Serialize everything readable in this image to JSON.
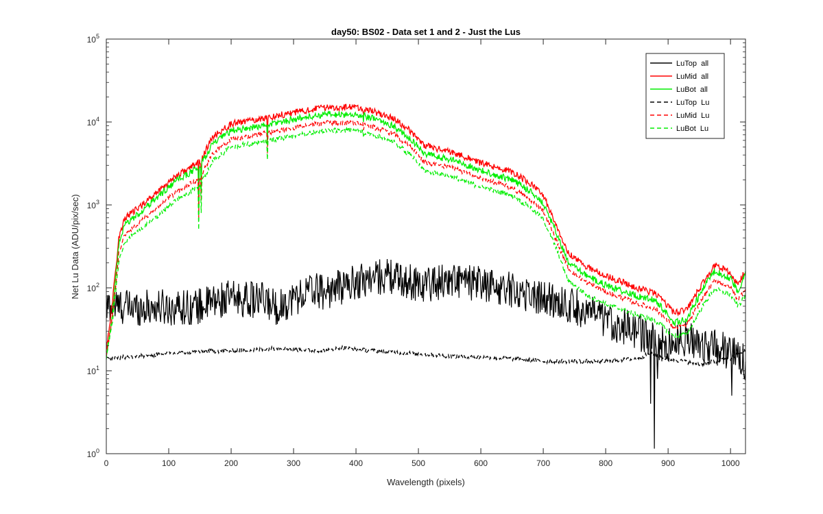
{
  "chart_data": {
    "type": "line",
    "title": "day50: BS02 - Data set 1 and 2 - Just the Lus",
    "xlabel": "Wavelength (pixels)",
    "ylabel": "Net Lu Data (ADU/pix/sec)",
    "xlim": [
      0,
      1024
    ],
    "ylim": [
      1,
      100000
    ],
    "yscale": "log",
    "grid": false,
    "legend_position": "top-right",
    "x_ticks": [
      "0",
      "100",
      "200",
      "300",
      "400",
      "500",
      "600",
      "700",
      "800",
      "900",
      "1000"
    ],
    "y_tick_exponents": [
      "0",
      "1",
      "2",
      "3",
      "4",
      "5"
    ],
    "y_tick_base": "10",
    "series": [
      {
        "name": "LuTop  all",
        "color": "#000000",
        "dash": "solid",
        "noise": 0.22,
        "points": [
          [
            0,
            55
          ],
          [
            5,
            62
          ],
          [
            15,
            60
          ],
          [
            50,
            58
          ],
          [
            100,
            58
          ],
          [
            150,
            60
          ],
          [
            180,
            70
          ],
          [
            200,
            75
          ],
          [
            250,
            70
          ],
          [
            275,
            58
          ],
          [
            300,
            75
          ],
          [
            330,
            95
          ],
          [
            350,
            90
          ],
          [
            380,
            105
          ],
          [
            420,
            130
          ],
          [
            450,
            140
          ],
          [
            480,
            120
          ],
          [
            510,
            110
          ],
          [
            550,
            125
          ],
          [
            600,
            110
          ],
          [
            650,
            95
          ],
          [
            700,
            75
          ],
          [
            750,
            60
          ],
          [
            800,
            40
          ],
          [
            850,
            30
          ],
          [
            880,
            22
          ],
          [
            900,
            20
          ],
          [
            930,
            25
          ],
          [
            960,
            20
          ],
          [
            990,
            18
          ],
          [
            1024,
            13
          ]
        ],
        "spikes": [
          [
            878,
            1.15
          ],
          [
            872,
            4
          ],
          [
            883,
            8
          ],
          [
            1002,
            5
          ]
        ]
      },
      {
        "name": "LuMid  all",
        "color": "#ff0000",
        "dash": "solid",
        "noise": 0.04,
        "points": [
          [
            0,
            18
          ],
          [
            10,
            70
          ],
          [
            20,
            400
          ],
          [
            30,
            700
          ],
          [
            50,
            900
          ],
          [
            80,
            1400
          ],
          [
            110,
            2200
          ],
          [
            150,
            3300
          ],
          [
            170,
            6500
          ],
          [
            200,
            9500
          ],
          [
            250,
            11000
          ],
          [
            300,
            13000
          ],
          [
            350,
            15000
          ],
          [
            400,
            15000
          ],
          [
            420,
            14000
          ],
          [
            460,
            11000
          ],
          [
            490,
            7500
          ],
          [
            510,
            5200
          ],
          [
            560,
            4200
          ],
          [
            600,
            3200
          ],
          [
            650,
            2500
          ],
          [
            680,
            1800
          ],
          [
            700,
            1300
          ],
          [
            720,
            600
          ],
          [
            740,
            260
          ],
          [
            770,
            180
          ],
          [
            800,
            140
          ],
          [
            850,
            100
          ],
          [
            880,
            85
          ],
          [
            910,
            50
          ],
          [
            930,
            55
          ],
          [
            960,
            130
          ],
          [
            975,
            190
          ],
          [
            1000,
            150
          ],
          [
            1012,
            110
          ],
          [
            1024,
            160
          ]
        ],
        "spikes": [
          [
            148,
            1800
          ],
          [
            152,
            2200
          ],
          [
            258,
            6800
          ],
          [
            412,
            12500
          ],
          [
            420,
            13000
          ]
        ]
      },
      {
        "name": "LuBot  all",
        "color": "#00ee00",
        "dash": "solid",
        "noise": 0.04,
        "points": [
          [
            0,
            15
          ],
          [
            10,
            50
          ],
          [
            20,
            330
          ],
          [
            30,
            580
          ],
          [
            50,
            760
          ],
          [
            80,
            1200
          ],
          [
            110,
            1900
          ],
          [
            150,
            2900
          ],
          [
            170,
            5400
          ],
          [
            200,
            7800
          ],
          [
            250,
            9000
          ],
          [
            300,
            10800
          ],
          [
            350,
            12300
          ],
          [
            400,
            12300
          ],
          [
            420,
            11500
          ],
          [
            460,
            9000
          ],
          [
            490,
            6000
          ],
          [
            510,
            4100
          ],
          [
            560,
            3400
          ],
          [
            600,
            2600
          ],
          [
            650,
            2000
          ],
          [
            680,
            1450
          ],
          [
            700,
            1050
          ],
          [
            720,
            480
          ],
          [
            740,
            200
          ],
          [
            770,
            140
          ],
          [
            800,
            108
          ],
          [
            850,
            80
          ],
          [
            880,
            70
          ],
          [
            910,
            38
          ],
          [
            930,
            42
          ],
          [
            960,
            110
          ],
          [
            975,
            160
          ],
          [
            1000,
            130
          ],
          [
            1012,
            90
          ],
          [
            1024,
            150
          ]
        ],
        "spikes": [
          [
            148,
            900
          ],
          [
            152,
            1500
          ],
          [
            258,
            5200
          ],
          [
            412,
            10000
          ],
          [
            420,
            10500
          ]
        ]
      },
      {
        "name": "LuTop  Lu",
        "color": "#000000",
        "dash": "dashed",
        "noise": 0.025,
        "points": [
          [
            0,
            14
          ],
          [
            50,
            15
          ],
          [
            100,
            16
          ],
          [
            150,
            17
          ],
          [
            200,
            17.5
          ],
          [
            250,
            18
          ],
          [
            280,
            19
          ],
          [
            300,
            18
          ],
          [
            350,
            17.5
          ],
          [
            380,
            19
          ],
          [
            400,
            18
          ],
          [
            450,
            17
          ],
          [
            500,
            16
          ],
          [
            550,
            15
          ],
          [
            600,
            14.5
          ],
          [
            650,
            14
          ],
          [
            700,
            13
          ],
          [
            750,
            13
          ],
          [
            800,
            13
          ],
          [
            850,
            14
          ],
          [
            870,
            16
          ],
          [
            900,
            14
          ],
          [
            950,
            12
          ],
          [
            1000,
            14
          ],
          [
            1024,
            18
          ]
        ],
        "spikes": []
      },
      {
        "name": "LuMid  Lu",
        "color": "#ff0000",
        "dash": "dashed",
        "noise": 0.03,
        "points": [
          [
            0,
            16
          ],
          [
            10,
            45
          ],
          [
            20,
            260
          ],
          [
            30,
            450
          ],
          [
            50,
            580
          ],
          [
            80,
            900
          ],
          [
            110,
            1400
          ],
          [
            150,
            2100
          ],
          [
            170,
            4200
          ],
          [
            200,
            6200
          ],
          [
            250,
            7200
          ],
          [
            300,
            8500
          ],
          [
            350,
            9800
          ],
          [
            400,
            9800
          ],
          [
            420,
            9100
          ],
          [
            460,
            7200
          ],
          [
            490,
            4800
          ],
          [
            510,
            3300
          ],
          [
            560,
            2700
          ],
          [
            600,
            2100
          ],
          [
            650,
            1600
          ],
          [
            680,
            1150
          ],
          [
            700,
            850
          ],
          [
            720,
            390
          ],
          [
            740,
            170
          ],
          [
            770,
            115
          ],
          [
            800,
            90
          ],
          [
            850,
            65
          ],
          [
            880,
            56
          ],
          [
            910,
            33
          ],
          [
            930,
            36
          ],
          [
            960,
            85
          ],
          [
            975,
            125
          ],
          [
            1000,
            100
          ],
          [
            1012,
            72
          ],
          [
            1024,
            100
          ]
        ],
        "spikes": [
          [
            148,
            700
          ],
          [
            152,
            1100
          ],
          [
            258,
            4200
          ],
          [
            412,
            8000
          ]
        ]
      },
      {
        "name": "LuBot  Lu",
        "color": "#00ee00",
        "dash": "dashed",
        "noise": 0.03,
        "points": [
          [
            0,
            14
          ],
          [
            10,
            40
          ],
          [
            20,
            210
          ],
          [
            30,
            360
          ],
          [
            50,
            470
          ],
          [
            80,
            720
          ],
          [
            110,
            1100
          ],
          [
            150,
            1700
          ],
          [
            170,
            3400
          ],
          [
            200,
            5000
          ],
          [
            250,
            5800
          ],
          [
            300,
            6800
          ],
          [
            350,
            7900
          ],
          [
            400,
            7900
          ],
          [
            420,
            7300
          ],
          [
            460,
            5800
          ],
          [
            490,
            3800
          ],
          [
            510,
            2600
          ],
          [
            560,
            2100
          ],
          [
            600,
            1650
          ],
          [
            650,
            1300
          ],
          [
            680,
            920
          ],
          [
            700,
            680
          ],
          [
            720,
            310
          ],
          [
            740,
            120
          ],
          [
            770,
            82
          ],
          [
            800,
            64
          ],
          [
            850,
            47
          ],
          [
            880,
            40
          ],
          [
            910,
            26
          ],
          [
            930,
            28
          ],
          [
            960,
            68
          ],
          [
            975,
            98
          ],
          [
            1000,
            82
          ],
          [
            1012,
            60
          ],
          [
            1024,
            80
          ]
        ],
        "spikes": [
          [
            148,
            500
          ],
          [
            152,
            800
          ],
          [
            258,
            3500
          ],
          [
            412,
            6500
          ]
        ]
      }
    ]
  }
}
